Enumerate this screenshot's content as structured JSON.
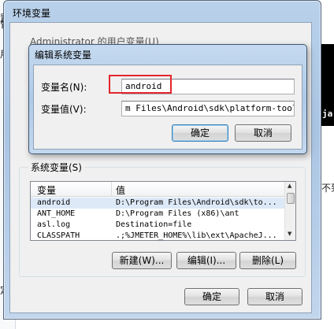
{
  "background": {
    "left_fragments": [
      "置",
      "管理",
      "用",
      "定"
    ],
    "right_code": "ja",
    "right_text": "不到"
  },
  "main_window": {
    "title": "环境变量",
    "user_vars_label": "Administrator 的用户变量(U)",
    "system_group_label": "系统变量(S)",
    "columns": [
      "变量",
      "值"
    ],
    "rows": [
      {
        "name": "android",
        "value": "D:\\Program Files\\Android\\sdk\\to..."
      },
      {
        "name": "ANT_HOME",
        "value": "D:\\Program Files (x86)\\ant"
      },
      {
        "name": "asl.log",
        "value": "Destination=file"
      },
      {
        "name": "CLASSPATH",
        "value": ".;%JMETER_HOME%\\lib\\ext\\ApacheJ..."
      }
    ],
    "new_button": "新建(W)...",
    "edit_button": "编辑(I)...",
    "delete_button": "删除(L)",
    "ok_button": "确定",
    "cancel_button": "取消"
  },
  "edit_dialog": {
    "title": "编辑系统变量",
    "name_label": "变量名(N):",
    "name_value": "android",
    "value_label": "变量值(V):",
    "value_value": "m Files\\Android\\sdk\\platform-tools;",
    "ok_button": "确定",
    "cancel_button": "取消"
  },
  "colors": {
    "highlight_border": "#e3262c",
    "title_gradient": "#b9d1ea",
    "selected_row": "#dde9f7"
  }
}
